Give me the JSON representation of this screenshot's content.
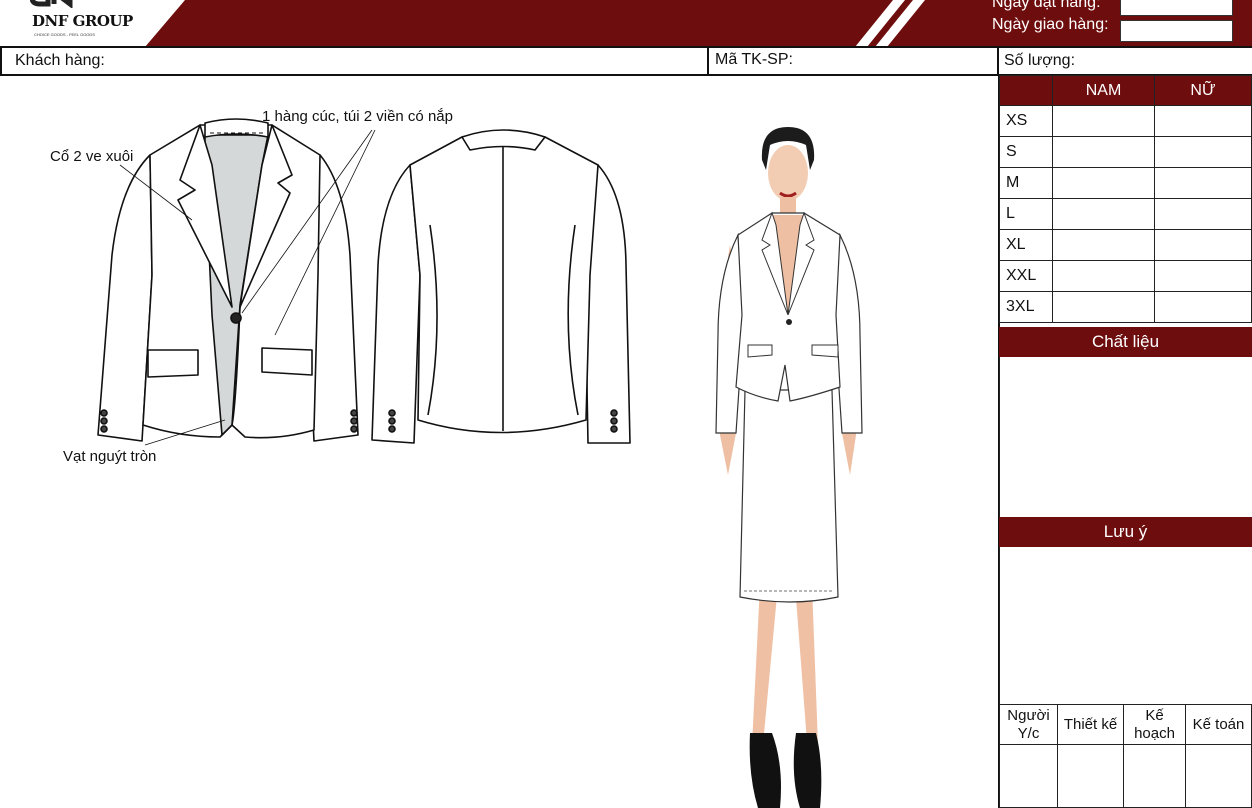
{
  "brand": {
    "name": "DNF GROUP",
    "tagline": "CHOICE GOODS - FEEL GOODS"
  },
  "header": {
    "order_date_label": "Ngày đặt hàng:",
    "delivery_date_label": "Ngày giao hàng:",
    "order_date_value": "",
    "delivery_date_value": ""
  },
  "info_row": {
    "customer_label": "Khách hàng:",
    "product_code_label": "Mã TK-SP:",
    "quantity_label": "Số lượng:"
  },
  "size_table": {
    "columns": [
      "NAM",
      "NỮ"
    ],
    "sizes": [
      "XS",
      "S",
      "M",
      "L",
      "XL",
      "XXL",
      "3XL"
    ]
  },
  "sections": {
    "material": "Chất liệu",
    "notes": "Lưu ý"
  },
  "signatures": [
    "Người Y/c",
    "Thiết kế",
    "Kế hoạch",
    "Kế toán"
  ],
  "annotations": {
    "collar": "Cổ 2 ve xuôi",
    "buttons_pockets": "1 hàng cúc, túi 2 viền có nắp",
    "hem": "Vạt nguýt tròn"
  },
  "colors": {
    "brand": "#6e0d0d",
    "lining": "#d4d8d8"
  }
}
